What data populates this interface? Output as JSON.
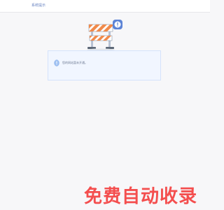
{
  "header": {
    "title": "系统提示"
  },
  "notice": {
    "message": "您的网站暂未开通。",
    "icon": "info-bubble-icon"
  },
  "illustration": {
    "name": "road-barrier-warning-illustration"
  },
  "watermark": {
    "text": "免费自动收录"
  },
  "colors": {
    "accent": "#6b86c2",
    "panel_bg": "#f1f6ff",
    "barrier_orange": "#f08a4b",
    "watermark_red": "#f44040"
  }
}
